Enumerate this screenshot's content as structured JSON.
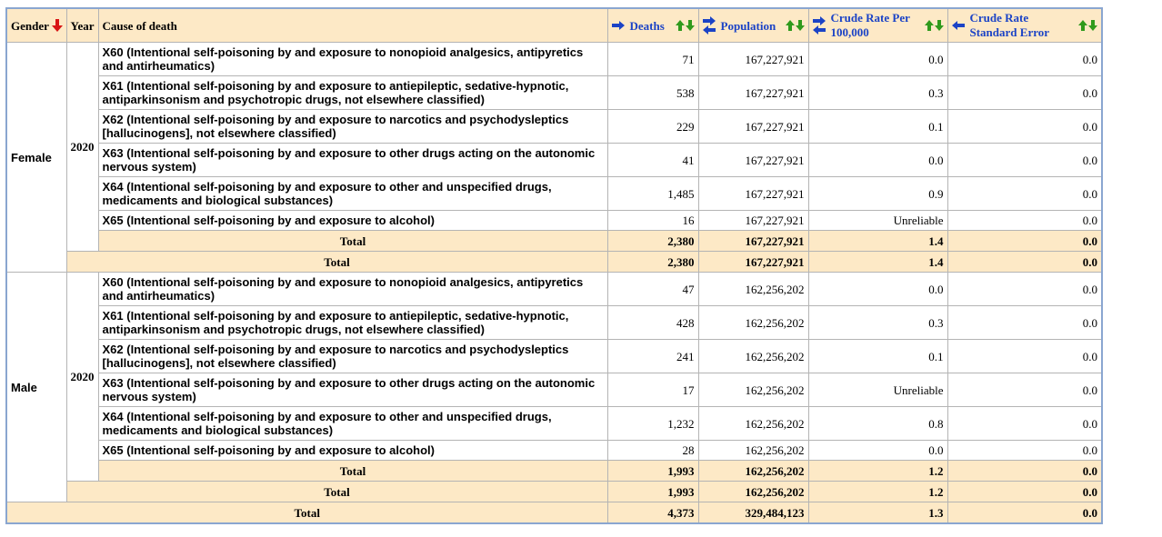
{
  "colors": {
    "header_bg": "#fde9c6",
    "link_blue": "#1b43c6",
    "border_blue": "#8aa6d0",
    "arrow_red": "#d81414",
    "arrow_green": "#2f9a1c"
  },
  "header": {
    "gender": "Gender",
    "year": "Year",
    "cause": "Cause of death",
    "deaths": "Deaths",
    "population": "Population",
    "crude_rate_line1": "Crude Rate Per",
    "crude_rate_line2": "100,000",
    "crude_se_line1": "Crude Rate",
    "crude_se_line2": "Standard Error"
  },
  "groups": [
    {
      "gender": "Female",
      "year": "2020",
      "rows": [
        {
          "cause": "X60 (Intentional self-poisoning by and exposure to nonopioid analgesics, antipyretics and antirheumatics)",
          "deaths": "71",
          "population": "167,227,921",
          "rate": "0.0",
          "se": "0.0"
        },
        {
          "cause": "X61 (Intentional self-poisoning by and exposure to antiepileptic, sedative-hypnotic, antiparkinsonism and psychotropic drugs, not elsewhere classified)",
          "deaths": "538",
          "population": "167,227,921",
          "rate": "0.3",
          "se": "0.0"
        },
        {
          "cause": "X62 (Intentional self-poisoning by and exposure to narcotics and psychodysleptics [hallucinogens], not elsewhere classified)",
          "deaths": "229",
          "population": "167,227,921",
          "rate": "0.1",
          "se": "0.0"
        },
        {
          "cause": "X63 (Intentional self-poisoning by and exposure to other drugs acting on the autonomic nervous system)",
          "deaths": "41",
          "population": "167,227,921",
          "rate": "0.0",
          "se": "0.0"
        },
        {
          "cause": "X64 (Intentional self-poisoning by and exposure to other and unspecified drugs, medicaments and biological substances)",
          "deaths": "1,485",
          "population": "167,227,921",
          "rate": "0.9",
          "se": "0.0"
        },
        {
          "cause": "X65 (Intentional self-poisoning by and exposure to alcohol)",
          "deaths": "16",
          "population": "167,227,921",
          "rate": "Unreliable",
          "se": "0.0"
        }
      ],
      "year_total": {
        "label": "Total",
        "deaths": "2,380",
        "population": "167,227,921",
        "rate": "1.4",
        "se": "0.0"
      },
      "gender_total": {
        "label": "Total",
        "deaths": "2,380",
        "population": "167,227,921",
        "rate": "1.4",
        "se": "0.0"
      }
    },
    {
      "gender": "Male",
      "year": "2020",
      "rows": [
        {
          "cause": "X60 (Intentional self-poisoning by and exposure to nonopioid analgesics, antipyretics and antirheumatics)",
          "deaths": "47",
          "population": "162,256,202",
          "rate": "0.0",
          "se": "0.0"
        },
        {
          "cause": "X61 (Intentional self-poisoning by and exposure to antiepileptic, sedative-hypnotic, antiparkinsonism and psychotropic drugs, not elsewhere classified)",
          "deaths": "428",
          "population": "162,256,202",
          "rate": "0.3",
          "se": "0.0"
        },
        {
          "cause": "X62 (Intentional self-poisoning by and exposure to narcotics and psychodysleptics [hallucinogens], not elsewhere classified)",
          "deaths": "241",
          "population": "162,256,202",
          "rate": "0.1",
          "se": "0.0"
        },
        {
          "cause": "X63 (Intentional self-poisoning by and exposure to other drugs acting on the autonomic nervous system)",
          "deaths": "17",
          "population": "162,256,202",
          "rate": "Unreliable",
          "se": "0.0"
        },
        {
          "cause": "X64 (Intentional self-poisoning by and exposure to other and unspecified drugs, medicaments and biological substances)",
          "deaths": "1,232",
          "population": "162,256,202",
          "rate": "0.8",
          "se": "0.0"
        },
        {
          "cause": "X65 (Intentional self-poisoning by and exposure to alcohol)",
          "deaths": "28",
          "population": "162,256,202",
          "rate": "0.0",
          "se": "0.0"
        }
      ],
      "year_total": {
        "label": "Total",
        "deaths": "1,993",
        "population": "162,256,202",
        "rate": "1.2",
        "se": "0.0"
      },
      "gender_total": {
        "label": "Total",
        "deaths": "1,993",
        "population": "162,256,202",
        "rate": "1.2",
        "se": "0.0"
      }
    }
  ],
  "grand_total": {
    "label": "Total",
    "deaths": "4,373",
    "population": "329,484,123",
    "rate": "1.3",
    "se": "0.0"
  }
}
